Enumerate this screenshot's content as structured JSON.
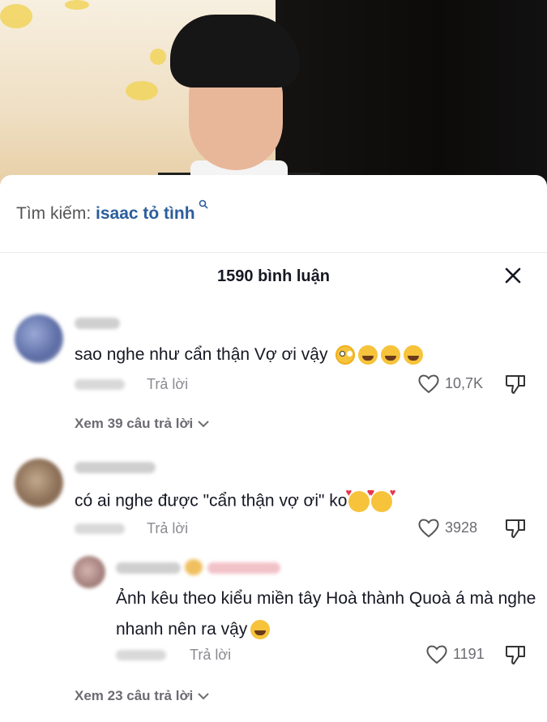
{
  "search": {
    "label": "Tìm kiếm:",
    "query": "isaac tỏ tình"
  },
  "header": {
    "count_label": "1590 bình luận"
  },
  "comments": [
    {
      "text": "sao nghe như cẩn thận Vợ ơi vậy",
      "emojis": [
        "flushed-face",
        "laughing-face",
        "laughing-face",
        "laughing-face"
      ],
      "reply_label": "Trả lời",
      "likes": "10,7K",
      "more_replies": "Xem 39 câu trả lời"
    },
    {
      "text": "có ai nghe được \"cẩn thận vợ ơi\" ko",
      "emojis": [
        "smiling-face-with-hearts",
        "smiling-face-with-hearts"
      ],
      "reply_label": "Trả lời",
      "likes": "3928",
      "reply": {
        "text": "Ảnh kêu theo kiểu miền tây Hoà thành Quoà á mà nghe nhanh nên ra vậy",
        "emojis": [
          "laughing-face"
        ],
        "reply_label": "Trả lời",
        "likes": "1191"
      },
      "more_replies": "Xem 23 câu trả lời"
    }
  ],
  "colors": {
    "accent_query": "#2b5e9c",
    "secondary_text": "#8a8b91"
  }
}
